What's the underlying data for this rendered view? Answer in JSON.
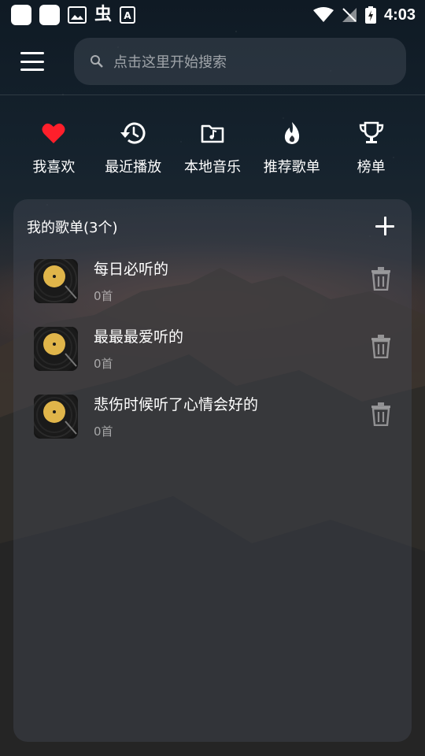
{
  "status_bar": {
    "time": "4:03"
  },
  "header": {
    "search_placeholder": "点击这里开始搜索"
  },
  "quick_nav": [
    {
      "label": "我喜欢",
      "icon": "heart-icon"
    },
    {
      "label": "最近播放",
      "icon": "history-icon"
    },
    {
      "label": "本地音乐",
      "icon": "music-folder-icon"
    },
    {
      "label": "推荐歌单",
      "icon": "flame-icon"
    },
    {
      "label": "榜单",
      "icon": "trophy-icon"
    }
  ],
  "playlists": {
    "title": "我的歌单(3个)",
    "items": [
      {
        "name": "每日必听的",
        "count": "0首"
      },
      {
        "name": "最最最爱听的",
        "count": "0首"
      },
      {
        "name": "悲伤时候听了心情会好的",
        "count": "0首"
      }
    ]
  },
  "colors": {
    "heart": "#ff1f2b",
    "panel": "#464b55"
  }
}
